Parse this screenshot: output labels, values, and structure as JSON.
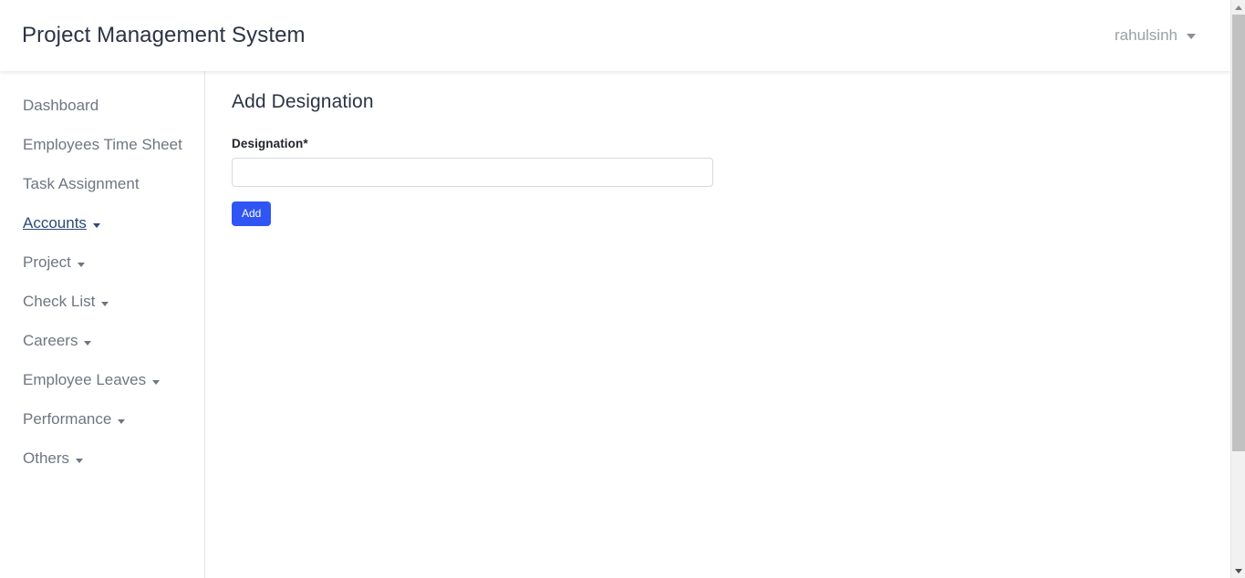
{
  "header": {
    "brand": "Project Management System",
    "user": {
      "name": "rahulsinh",
      "caret_icon": "chevron-down-icon"
    }
  },
  "sidebar": {
    "items": [
      {
        "label": "Dashboard",
        "has_caret": false,
        "active": false
      },
      {
        "label": "Employees Time Sheet",
        "has_caret": false,
        "active": false
      },
      {
        "label": "Task Assignment",
        "has_caret": false,
        "active": false
      },
      {
        "label": "Accounts",
        "has_caret": true,
        "active": true
      },
      {
        "label": "Project",
        "has_caret": true,
        "active": false
      },
      {
        "label": "Check List",
        "has_caret": true,
        "active": false
      },
      {
        "label": "Careers",
        "has_caret": true,
        "active": false
      },
      {
        "label": "Employee Leaves",
        "has_caret": true,
        "active": false
      },
      {
        "label": "Performance",
        "has_caret": true,
        "active": false
      },
      {
        "label": "Others",
        "has_caret": true,
        "active": false
      }
    ]
  },
  "main": {
    "title": "Add Designation",
    "form": {
      "designation": {
        "label": "Designation*",
        "value": "",
        "placeholder": ""
      },
      "submit_label": "Add"
    }
  },
  "scrollbar": {
    "up_icon": "caret-up-icon",
    "down_icon": "caret-down-icon"
  },
  "colors": {
    "brand_text": "#2c3345",
    "muted_text": "#6f7680",
    "active_link": "#2b4a74",
    "primary_button": "#2f55f5",
    "input_border": "#d6d9dd",
    "scroll_thumb": "#c1c1c1"
  }
}
